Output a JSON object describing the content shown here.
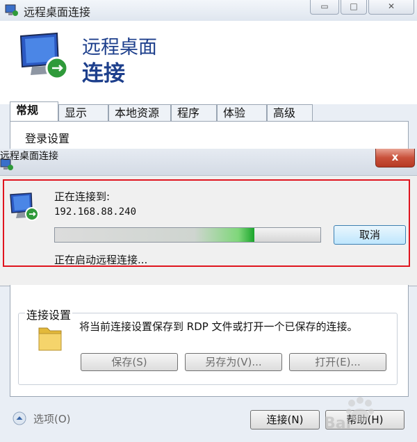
{
  "main_window": {
    "title": "远程桌面连接",
    "header_line1": "远程桌面",
    "header_line2": "连接",
    "tabs": [
      {
        "label": "常规",
        "active": true
      },
      {
        "label": "显示",
        "active": false
      },
      {
        "label": "本地资源",
        "active": false
      },
      {
        "label": "程序",
        "active": false
      },
      {
        "label": "体验",
        "active": false
      },
      {
        "label": "高级",
        "active": false
      }
    ],
    "login_group_title": "登录设置",
    "connection_group_title": "连接设置",
    "connection_desc": "将当前连接设置保存到 RDP 文件或打开一个已保存的连接。",
    "save_button": "保存(S)",
    "save_as_button": "另存为(V)...",
    "open_button": "打开(E)...",
    "options_label": "选项(O)",
    "connect_button": "连接(N)",
    "help_button": "帮助(H)"
  },
  "dialog": {
    "title": "远程桌面连接",
    "close_glyph": "x",
    "connecting_label": "正在连接到:",
    "address": "192.168.88.240",
    "progress": 0.75,
    "cancel_button": "取消",
    "status": "正在启动远程连接..."
  },
  "colors": {
    "title_blue": "#1d3f8c",
    "highlight_red": "#e0141e",
    "progress_green": "#1aa52b"
  }
}
